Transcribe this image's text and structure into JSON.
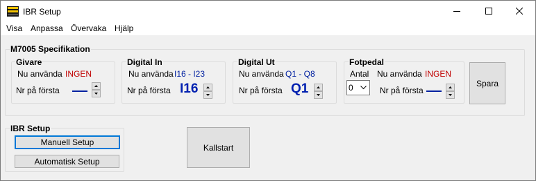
{
  "window": {
    "title": "IBR Setup"
  },
  "menu": [
    "Visa",
    "Anpassa",
    "Övervaka",
    "Hjälp"
  ],
  "spec": {
    "title": "M7005 Specifikation",
    "givare": {
      "title": "Givare",
      "in_use_label": "Nu använda",
      "in_use_value": "INGEN",
      "first_label": "Nr på första"
    },
    "digital_in": {
      "title": "Digital In",
      "in_use_label": "Nu använda",
      "in_use_value": "I16 - I23",
      "first_label": "Nr på första",
      "first_value": "I16"
    },
    "digital_ut": {
      "title": "Digital Ut",
      "in_use_label": "Nu använda",
      "in_use_value": "Q1 - Q8",
      "first_label": "Nr på första",
      "first_value": "Q1"
    },
    "fotpedal": {
      "title": "Fotpedal",
      "antal_label": "Antal",
      "antal_value": "0",
      "in_use_label": "Nu använda",
      "in_use_value": "INGEN",
      "first_label": "Nr på första"
    },
    "save_label": "Spara"
  },
  "ibr_setup": {
    "title": "IBR Setup",
    "manual_label": "Manuell Setup",
    "auto_label": "Automatisk Setup"
  },
  "coldstart_label": "Kallstart",
  "colors": {
    "red": "#c00000",
    "blue": "#0020a0",
    "focus": "#0078d7"
  }
}
